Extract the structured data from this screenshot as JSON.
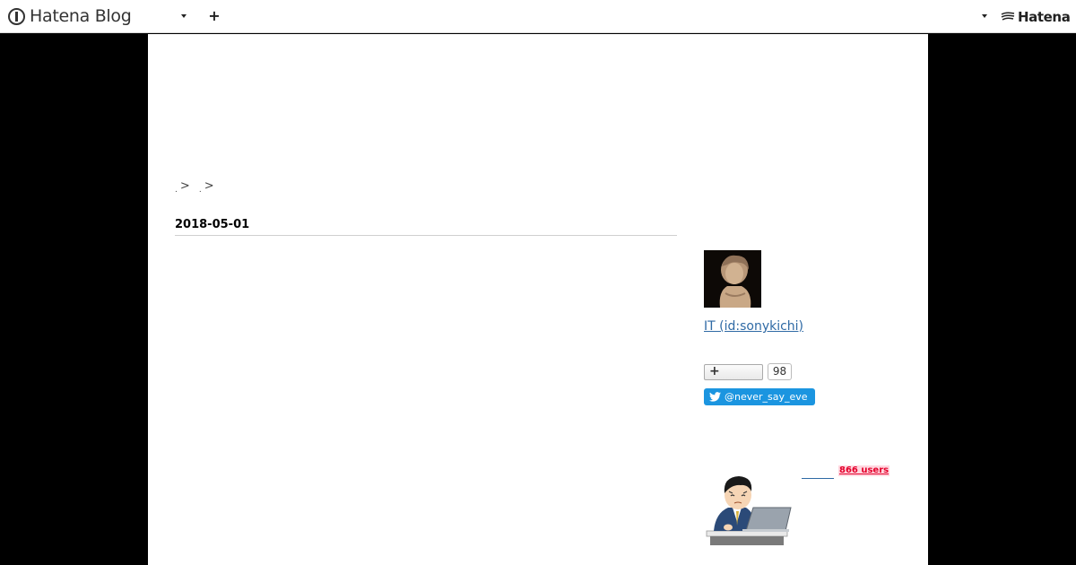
{
  "topbar": {
    "brand_name": "Hatena Blog",
    "hatena_name": "Hatena"
  },
  "content": {
    "breadcrumb": [
      ">",
      ">"
    ],
    "date": "2018-05-01"
  },
  "sidebar": {
    "profile_link": "IT (id:sonykichi)",
    "follow_count": "98",
    "twitter_handle": "@never_say_eve",
    "users_badge": "866 users"
  },
  "colors": {
    "link": "#2f6aa5",
    "twitter": "#1b95e0",
    "users_badge": "#e4002b"
  }
}
